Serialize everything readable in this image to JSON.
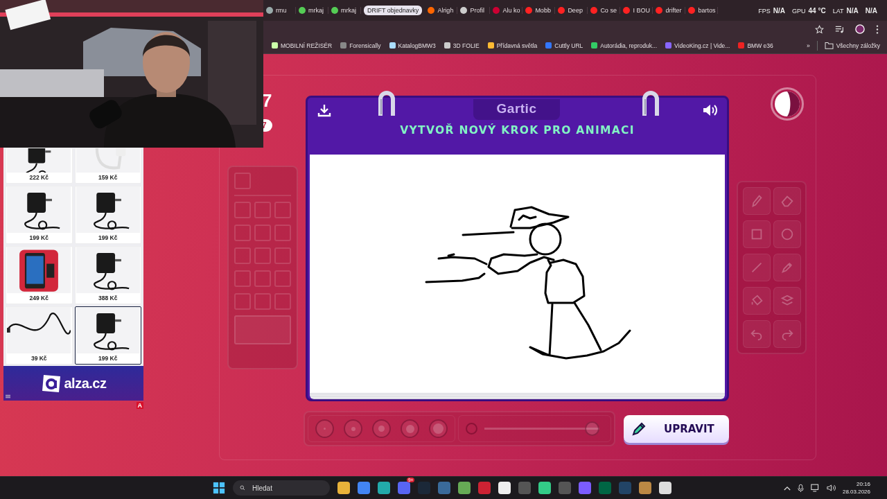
{
  "score_fragments": [
    "7",
    "7"
  ],
  "tabs": [
    {
      "kind": "tab",
      "title": "rmu",
      "selected": false
    },
    {
      "kind": "tab",
      "title": "mrkaj",
      "selected": false
    },
    {
      "kind": "tab",
      "title": "mrkaj",
      "selected": false
    },
    {
      "kind": "group",
      "title": "DRIFT objednavky"
    },
    {
      "kind": "tab",
      "title": "Alrigh",
      "selected": false
    },
    {
      "kind": "tab",
      "title": "Profil",
      "selected": false
    },
    {
      "kind": "tab",
      "title": "Alu ko",
      "selected": false
    },
    {
      "kind": "tab",
      "title": "Mobb",
      "selected": false
    },
    {
      "kind": "tab",
      "title": "Deep",
      "selected": false
    },
    {
      "kind": "tab",
      "title": "Co se",
      "selected": false
    },
    {
      "kind": "tab",
      "title": "I BOU",
      "selected": false
    },
    {
      "kind": "tab",
      "title": "drifter",
      "selected": false
    },
    {
      "kind": "tab",
      "title": "bartos",
      "selected": false
    }
  ],
  "stream_overlay": {
    "fps_label": "FPS",
    "fps_value": "N/A",
    "gpu_label": "GPU",
    "gpu_value": "44 °C",
    "lat_label": "LAT",
    "lat_value": "N/A",
    "extra_value": "N/A"
  },
  "bookmarks": [
    "MOBILNÍ REŽISÉR",
    "Forensically",
    "KatalogBMW3",
    "3D FOLIE",
    "Přídavná světla",
    "Cuttly URL",
    "Autorádia, reproduk...",
    "VideoKing.cz | Vide...",
    "BMW e36"
  ],
  "bookmarks_more": "»",
  "all_bookmarks": "Všechny záložky",
  "ad": {
    "products": [
      {
        "price": "222 Kč",
        "selected": false
      },
      {
        "price": "159 Kč",
        "selected": false
      },
      {
        "price": "199 Kč",
        "selected": false
      },
      {
        "price": "199 Kč",
        "selected": false
      },
      {
        "price": "249 Kč",
        "selected": false
      },
      {
        "price": "388 Kč",
        "selected": false
      },
      {
        "price": "39 Kč",
        "selected": false
      },
      {
        "price": "199 Kč",
        "selected": true
      }
    ],
    "brand": "alza.cz",
    "badge": "A"
  },
  "game": {
    "logo": "Gartic",
    "title": "VYTVOŘ NOVÝ KROK PRO ANIMACI",
    "opacity_slider": {
      "level": 1
    },
    "button": "UPRAVIT"
  },
  "taskbar": {
    "search_placeholder": "Hledat",
    "notification_badge": "9+",
    "time": "20:16",
    "date": "28.03.2026"
  }
}
